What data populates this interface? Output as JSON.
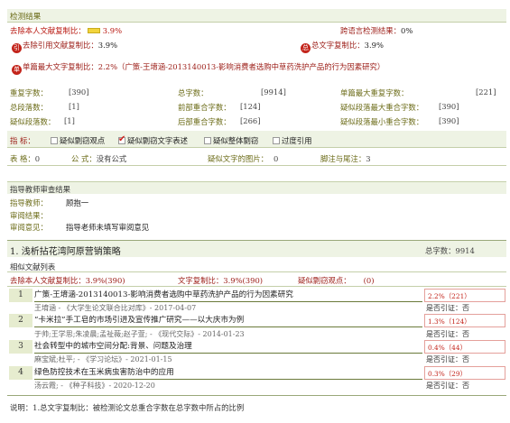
{
  "header": {
    "title": "检测结果"
  },
  "summary": {
    "self_excluded_label": "去除本人文献复制比：",
    "self_excluded_value": "3.9%",
    "cross_language_label": "跨语言检测结果：",
    "cross_language_value": "0%",
    "cite_excluded_badge": "引",
    "cite_excluded_label": "去除引用文献复制比：",
    "cite_excluded_value": "3.9%",
    "total_badge": "总",
    "total_label": "总文字复制比：",
    "total_value": "3.9%",
    "single_badge": "单",
    "single_label": "单篇最大文字复制比：",
    "single_value": "2.2%",
    "single_title": "（广策-王堉涵-2013140013-影响消费者选购中草药洗护产品的行为因素研究）"
  },
  "stats": [
    {
      "label": "重复字数：",
      "value": "[390]"
    },
    {
      "label": "总字数：",
      "value": "[9914]"
    },
    {
      "label": "单篇最大重复字数：",
      "value": "[221]"
    },
    {
      "label": "总段落数：",
      "value": "[1]"
    },
    {
      "label": "前部重合字数：",
      "value": "[124]"
    },
    {
      "label": "疑似段落最大重合字数：",
      "value": "[390]"
    },
    {
      "label": "疑似段落数：",
      "value": "[1]"
    },
    {
      "label": "后部重合字数：",
      "value": "[266]"
    },
    {
      "label": "疑似段落最小重合字数：",
      "value": "[390]"
    }
  ],
  "indicators": {
    "label": "指    标：",
    "options": [
      {
        "label": "疑似剽窃观点",
        "checked": false
      },
      {
        "label": "疑似剽窃文字表述",
        "checked": true
      },
      {
        "label": "疑似整体剽窃",
        "checked": false
      },
      {
        "label": "过度引用",
        "checked": false
      }
    ]
  },
  "misc": {
    "table_label": "表    格：",
    "table_value": "0",
    "formula_label": "公    式：",
    "formula_value": "没有公式",
    "images_label": "疑似文字的图片：",
    "images_value": "0",
    "notes_label": "脚注与尾注：",
    "notes_value": "3"
  },
  "advisor": {
    "section_title": "指导教师审查结果",
    "teacher_label": "指导教师：",
    "teacher_value": "顾抱一",
    "result_label": "审阅结果：",
    "result_value": "",
    "opinion_label": "审阅意见：",
    "opinion_value": "指导老师未填写审阅意见"
  },
  "section": {
    "title": "1.  浅析拈花湾阿原营销策略",
    "word_count": "总字数：9914",
    "list_title": "相似文献列表",
    "self_excluded": "去除本人文献复制比：3.9%(390)",
    "copy_ratio": "文字复制比：3.9%(390)",
    "plagiarism_label": "疑似剽窃观点：",
    "plagiarism_value": "(0)"
  },
  "documents": [
    {
      "num": "1",
      "title": "广策-王堉涵-2013140013-影响消费者选购中草药洗护产品的行为因素研究",
      "source": "王堉涵 - 《大学生论文联合比对库》- 2017-04-07",
      "pct": "2.2%（221）",
      "cite": "是否引证：否"
    },
    {
      "num": "2",
      "title": "“卡米拉”手工皂的市场引进及宣传推广研究——以大庆市为例",
      "source": "于帅;王学思;朱凌晨;孟祉薇;赵子萱; - 《现代交际》- 2014-01-23",
      "pct": "1.3%（124）",
      "cite": "是否引证：否"
    },
    {
      "num": "3",
      "title": "社会转型中的城市空间分配:背景、问题及治理",
      "source": "麻宝斌;杜平; - 《学习论坛》- 2021-01-15",
      "pct": "0.4%（44）",
      "cite": "是否引证：否"
    },
    {
      "num": "4",
      "title": "绿色防控技术在玉米病虫害防治中的应用",
      "source": "汤云霞; - 《种子科技》- 2020-12-20",
      "pct": "0.3%（29）",
      "cite": "是否引证：否"
    }
  ],
  "footer": {
    "note": "说明：1.总文字复制比：被检测论文总重合字数在总字数中所占的比例"
  }
}
